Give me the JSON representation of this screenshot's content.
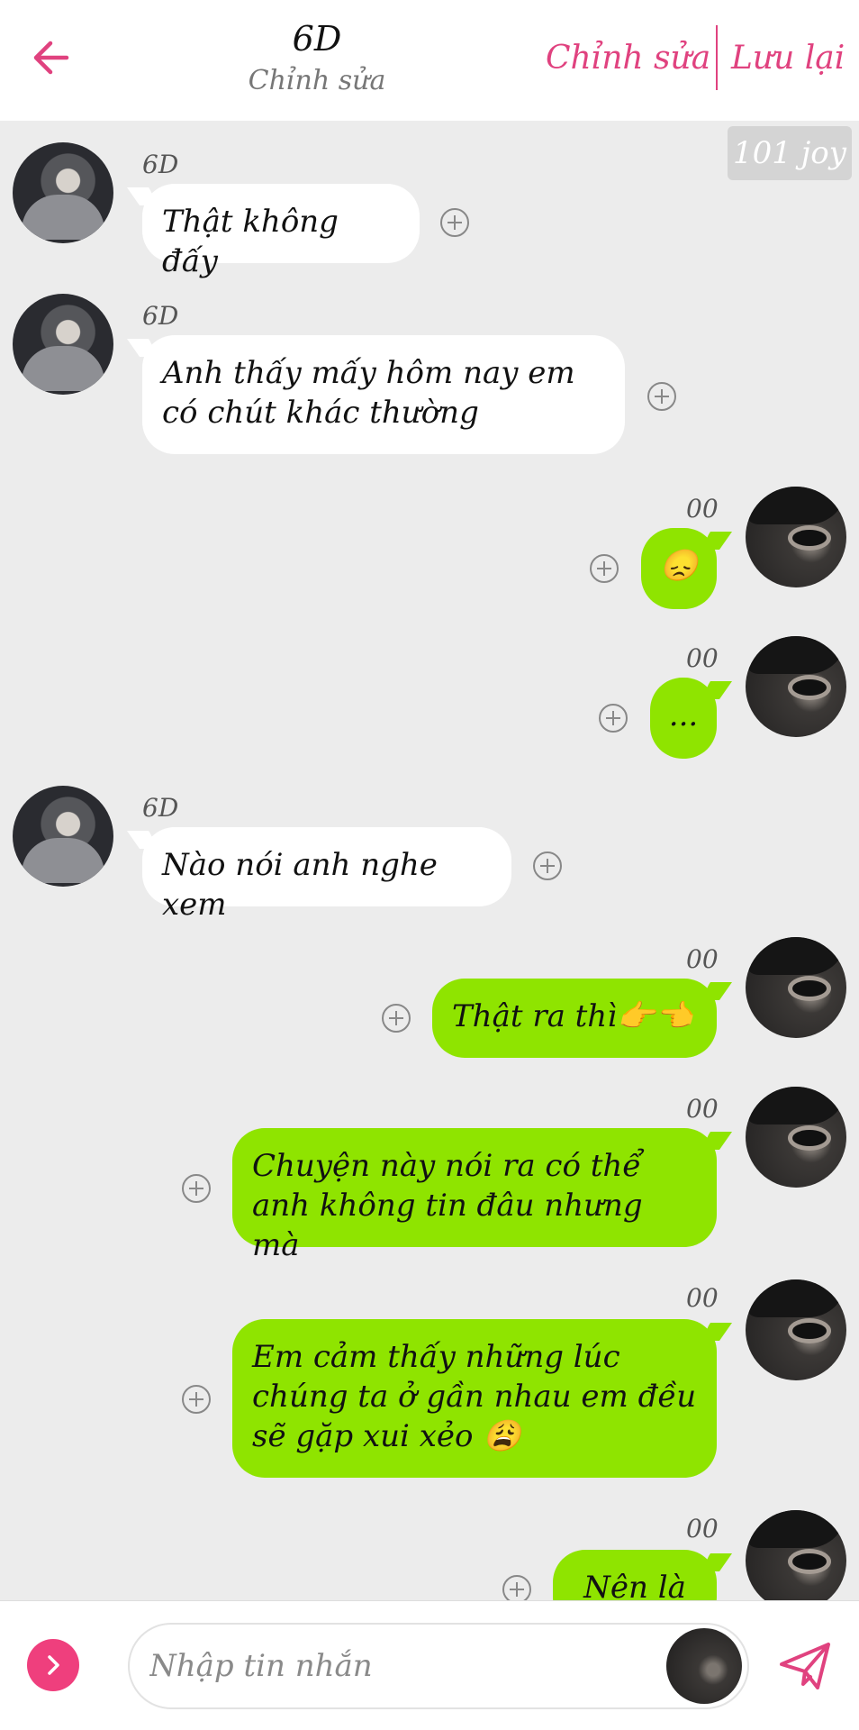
{
  "header": {
    "title": "6D",
    "subtitle": "Chỉnh sửa",
    "edit_label": "Chỉnh sửa",
    "save_label": "Lưu lại",
    "accent_color": "#e0427f"
  },
  "watermark": "101 joy",
  "messages": [
    {
      "side": "left",
      "sender": "6D",
      "text": "Thật không đấy"
    },
    {
      "side": "left",
      "sender": "6D",
      "text": "Anh thấy mấy hôm nay em có chút khác thường"
    },
    {
      "side": "right",
      "sender": "00",
      "text": "😞"
    },
    {
      "side": "right",
      "sender": "00",
      "text": "..."
    },
    {
      "side": "left",
      "sender": "6D",
      "text": "Nào nói anh nghe xem"
    },
    {
      "side": "right",
      "sender": "00",
      "text": "Thật ra thì👉👈"
    },
    {
      "side": "right",
      "sender": "00",
      "text": "Chuyện này nói ra có thể anh không tin đâu nhưng mà"
    },
    {
      "side": "right",
      "sender": "00",
      "text": "Em cảm thấy những lúc chúng ta ở gần nhau em đều sẽ gặp xui xẻo 😩"
    },
    {
      "side": "right",
      "sender": "00",
      "text": "Nên là"
    }
  ],
  "composer": {
    "placeholder": "Nhập tin nhắn"
  },
  "icons": {
    "back": "arrow-left-icon",
    "expand": "chevron-right-icon",
    "send": "paper-plane-icon",
    "add": "plus-circle-icon"
  },
  "colors": {
    "outgoing_bubble": "#8fe400",
    "incoming_bubble": "#ffffff",
    "background": "#ececec",
    "expand_button": "#ef3f7d"
  }
}
